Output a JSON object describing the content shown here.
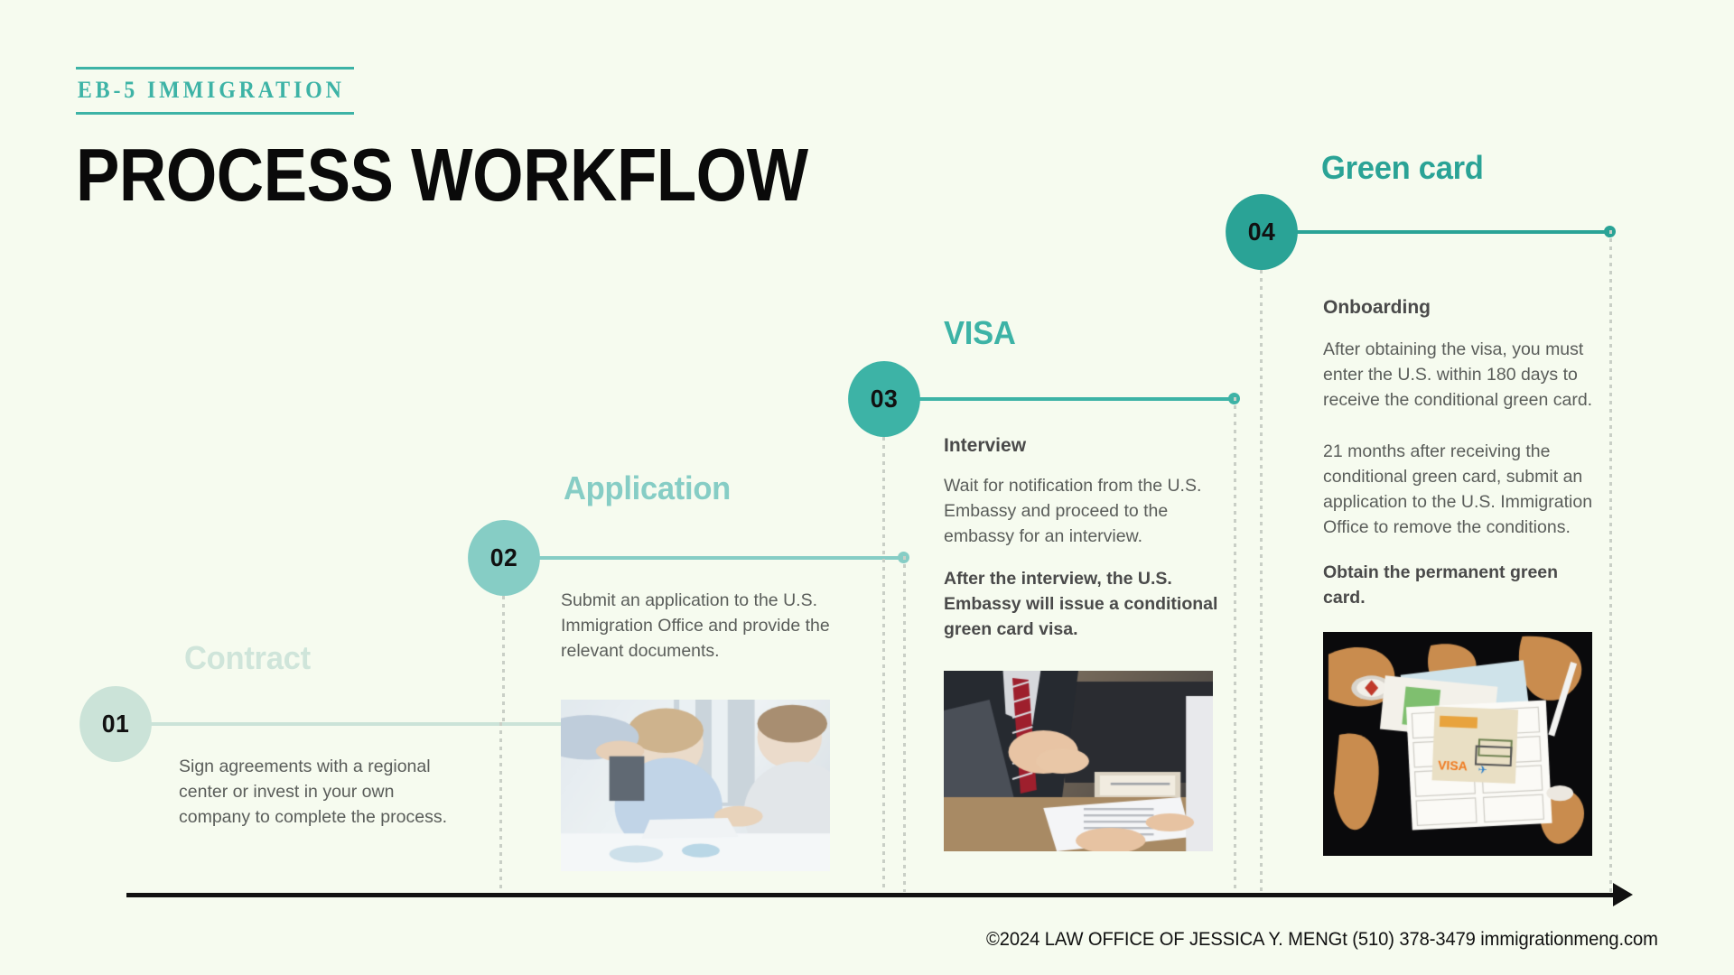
{
  "header": {
    "eyebrow": "EB-5 IMMIGRATION",
    "title": "PROCESS WORKFLOW"
  },
  "theme": {
    "background": "#f6fbef",
    "accent_dark": "#2aa396",
    "accent_mid": "#3db3a6",
    "accent_light": "#86cdc5",
    "accent_pale": "#cbe3d8",
    "text_body": "#5a5d5a",
    "text_head": "#4a4a4a",
    "axis": "#111111"
  },
  "steps": [
    {
      "number": "01",
      "title": "Contract",
      "subhead": "",
      "body": "Sign agreements with a regional center or invest in your own company to complete the process.",
      "body_bold": "",
      "photo_name": "",
      "color": "#cbe3d8",
      "title_color": "#cfe5da"
    },
    {
      "number": "02",
      "title": "Application",
      "subhead": "",
      "body": "Submit an application to the U.S. Immigration Office and provide the relevant documents.",
      "body_bold": "",
      "photo_name": "business-meeting-photo",
      "color": "#86cdc5",
      "title_color": "#86cdc5"
    },
    {
      "number": "03",
      "title": "VISA",
      "subhead": "Interview",
      "body": "Wait for notification from the U.S. Embassy and proceed to the embassy for an interview.",
      "body_bold": "After the interview, the U.S. Embassy will issue a conditional green card visa.",
      "photo_name": "handshake-interview-photo",
      "color": "#3db3a6",
      "title_color": "#3db3a6"
    },
    {
      "number": "04",
      "title": "Green card",
      "subhead": "Onboarding",
      "body": "After obtaining the visa, you must enter the U.S. within 180 days to receive the conditional green card.",
      "body2": "21 months after receiving the conditional green card, submit an application to the U.S. Immigration Office to remove the conditions.",
      "body_bold": "Obtain the permanent green card.",
      "photo_name": "travel-visa-documents-photo",
      "color": "#2aa396",
      "title_color": "#2aa396"
    }
  ],
  "footer": {
    "text": "©2024 LAW OFFICE OF JESSICA Y. MENGt (510) 378-3479 immigrationmeng.com"
  }
}
